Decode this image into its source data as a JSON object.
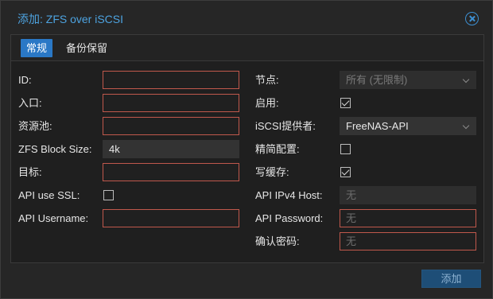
{
  "dialog": {
    "title": "添加: ZFS over iSCSI",
    "tabs": [
      {
        "label": "常规",
        "active": true
      },
      {
        "label": "备份保留",
        "active": false
      }
    ],
    "left": {
      "id": {
        "label": "ID:",
        "value": ""
      },
      "portal": {
        "label": "入口:",
        "value": ""
      },
      "pool": {
        "label": "资源池:",
        "value": ""
      },
      "block_size": {
        "label": "ZFS Block Size:",
        "value": "4k"
      },
      "target": {
        "label": "目标:",
        "value": ""
      },
      "api_ssl": {
        "label": "API use SSL:",
        "checked": false
      },
      "api_username": {
        "label": "API Username:",
        "value": ""
      }
    },
    "right": {
      "nodes": {
        "label": "节点:",
        "value": "所有 (无限制)"
      },
      "enable": {
        "label": "启用:",
        "checked": true
      },
      "provider": {
        "label": "iSCSI提供者:",
        "value": "FreeNAS-API"
      },
      "thin": {
        "label": "精简配置:",
        "checked": false
      },
      "writecache": {
        "label": "写缓存:",
        "checked": true
      },
      "api_ipv4": {
        "label": "API IPv4 Host:",
        "placeholder": "无"
      },
      "api_password": {
        "label": "API Password:",
        "placeholder": "无"
      },
      "confirm_password": {
        "label": "确认密码:",
        "placeholder": "无"
      }
    },
    "add_label": "添加"
  },
  "colors": {
    "accent": "#2a78c6",
    "title": "#4da3e0",
    "invalid_border": "#c0584c",
    "background": "#262626"
  },
  "icons": {
    "close": "close-circle-icon",
    "dropdown": "chevron-down-icon",
    "check": "checkmark-icon"
  }
}
